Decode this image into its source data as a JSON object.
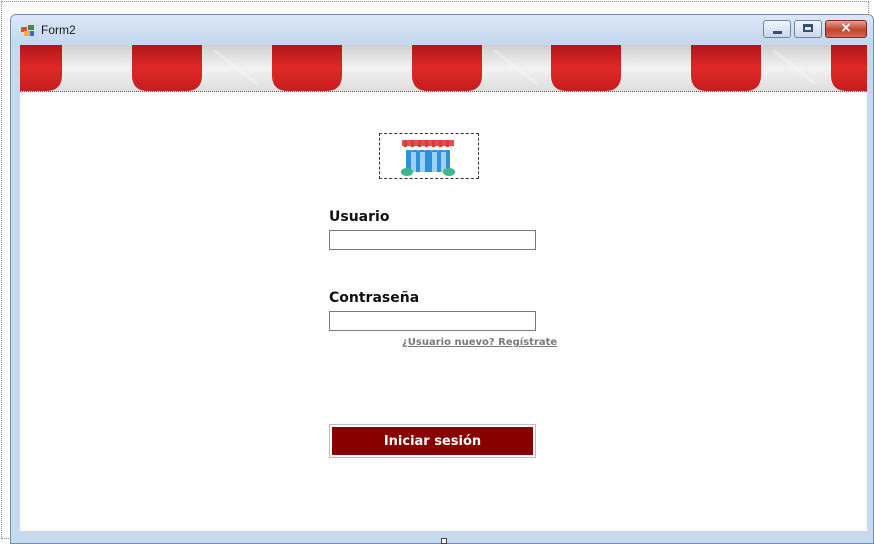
{
  "window": {
    "title": "Form2",
    "controls": {
      "minimize": "minimize",
      "maximize": "maximize",
      "close": "×"
    }
  },
  "colors": {
    "awning_red": "#cc1f1f",
    "awning_white": "#e6e6e6",
    "button_bg": "#880000",
    "button_text": "#ffffff",
    "link": "#7a7a7a"
  },
  "header": {
    "image": "store-awning-banner"
  },
  "logo": {
    "icon": "storefront-icon"
  },
  "form": {
    "username_label": "Usuario",
    "username_value": "",
    "password_label": "Contraseña",
    "password_value": "",
    "register_link": "¿Usuario nuevo? Regístrate",
    "login_button": "Iniciar sesión"
  }
}
